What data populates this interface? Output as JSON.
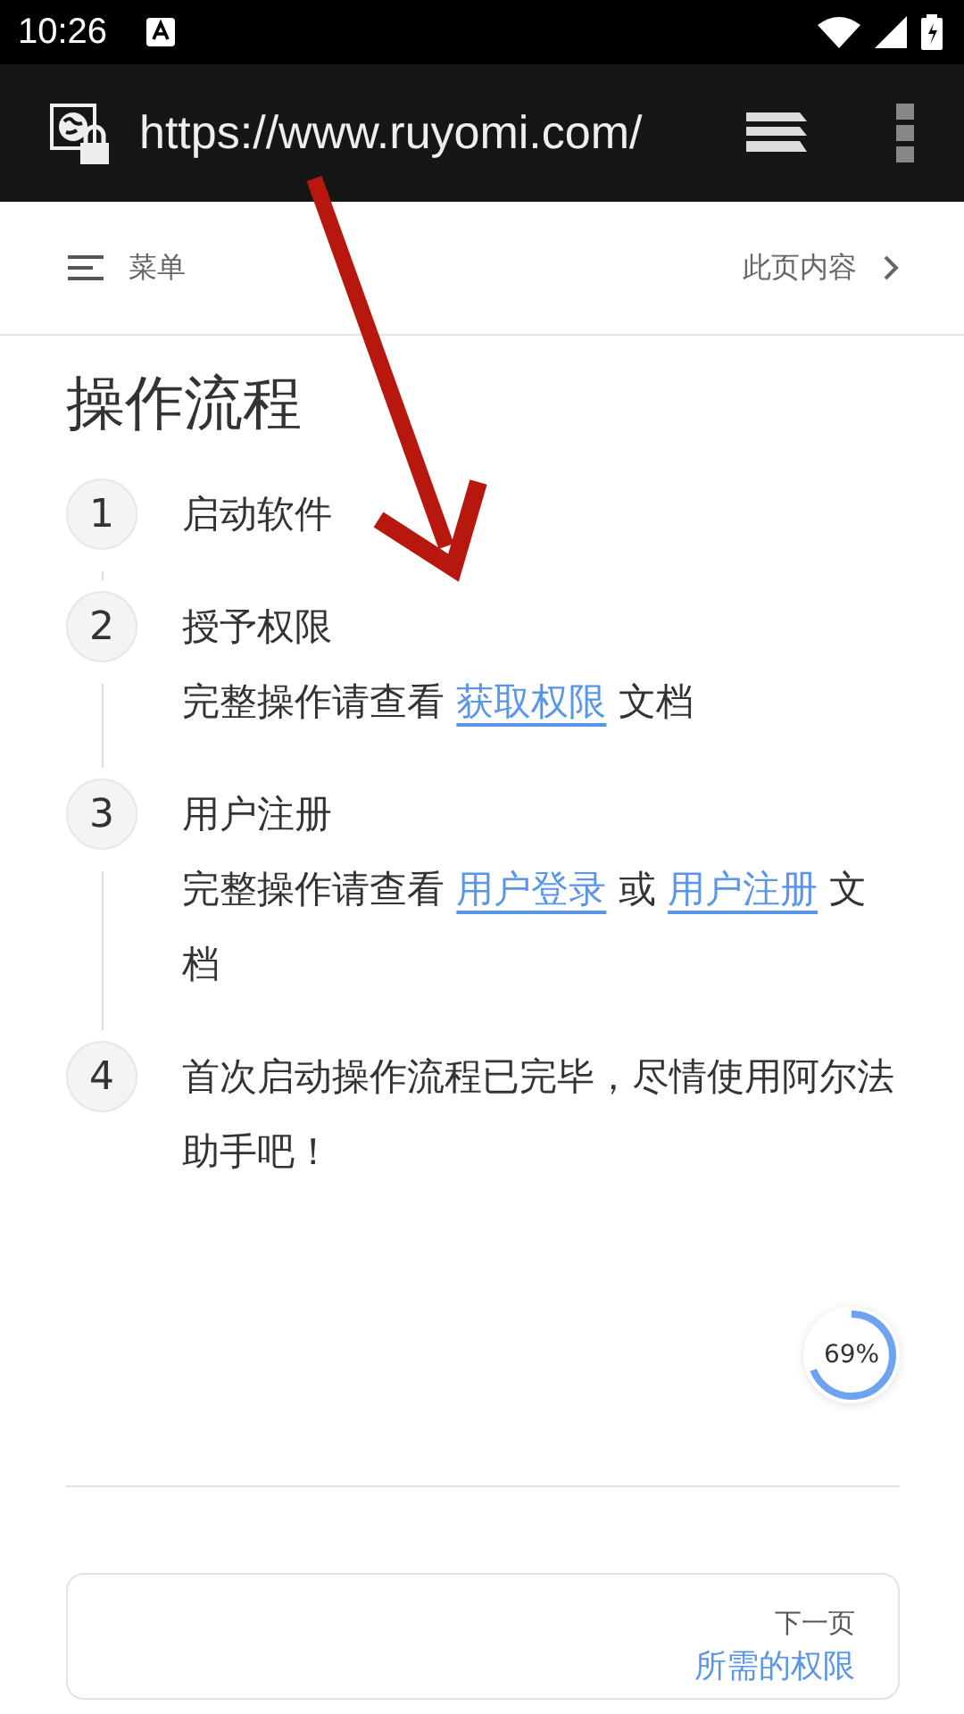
{
  "status_bar": {
    "time": "10:26"
  },
  "browser": {
    "url": "https://www.ruyomi.com/"
  },
  "nav": {
    "menu_label": "菜单",
    "toc_label": "此页内容"
  },
  "title": "操作流程",
  "steps": [
    {
      "number": "1",
      "title": "启动软件"
    },
    {
      "number": "2",
      "title": "授予权限",
      "description": [
        {
          "kind": "text",
          "text": "完整操作请查看 "
        },
        {
          "kind": "link",
          "text": "获取权限"
        },
        {
          "kind": "text",
          "text": " 文档"
        }
      ]
    },
    {
      "number": "3",
      "title": "用户注册",
      "description": [
        {
          "kind": "text",
          "text": "完整操作请查看 "
        },
        {
          "kind": "link",
          "text": "用户登录"
        },
        {
          "kind": "text",
          "text": " 或 "
        },
        {
          "kind": "link",
          "text": "用户注册"
        },
        {
          "kind": "text",
          "text": " 文档"
        }
      ]
    },
    {
      "number": "4",
      "title": "首次启动操作流程已完毕，尽情使用阿尔法助手吧！"
    }
  ],
  "reading_progress": {
    "level": 0.69,
    "reading": "69%"
  },
  "next_page": {
    "label": "下一页",
    "link": "所需的权限"
  }
}
